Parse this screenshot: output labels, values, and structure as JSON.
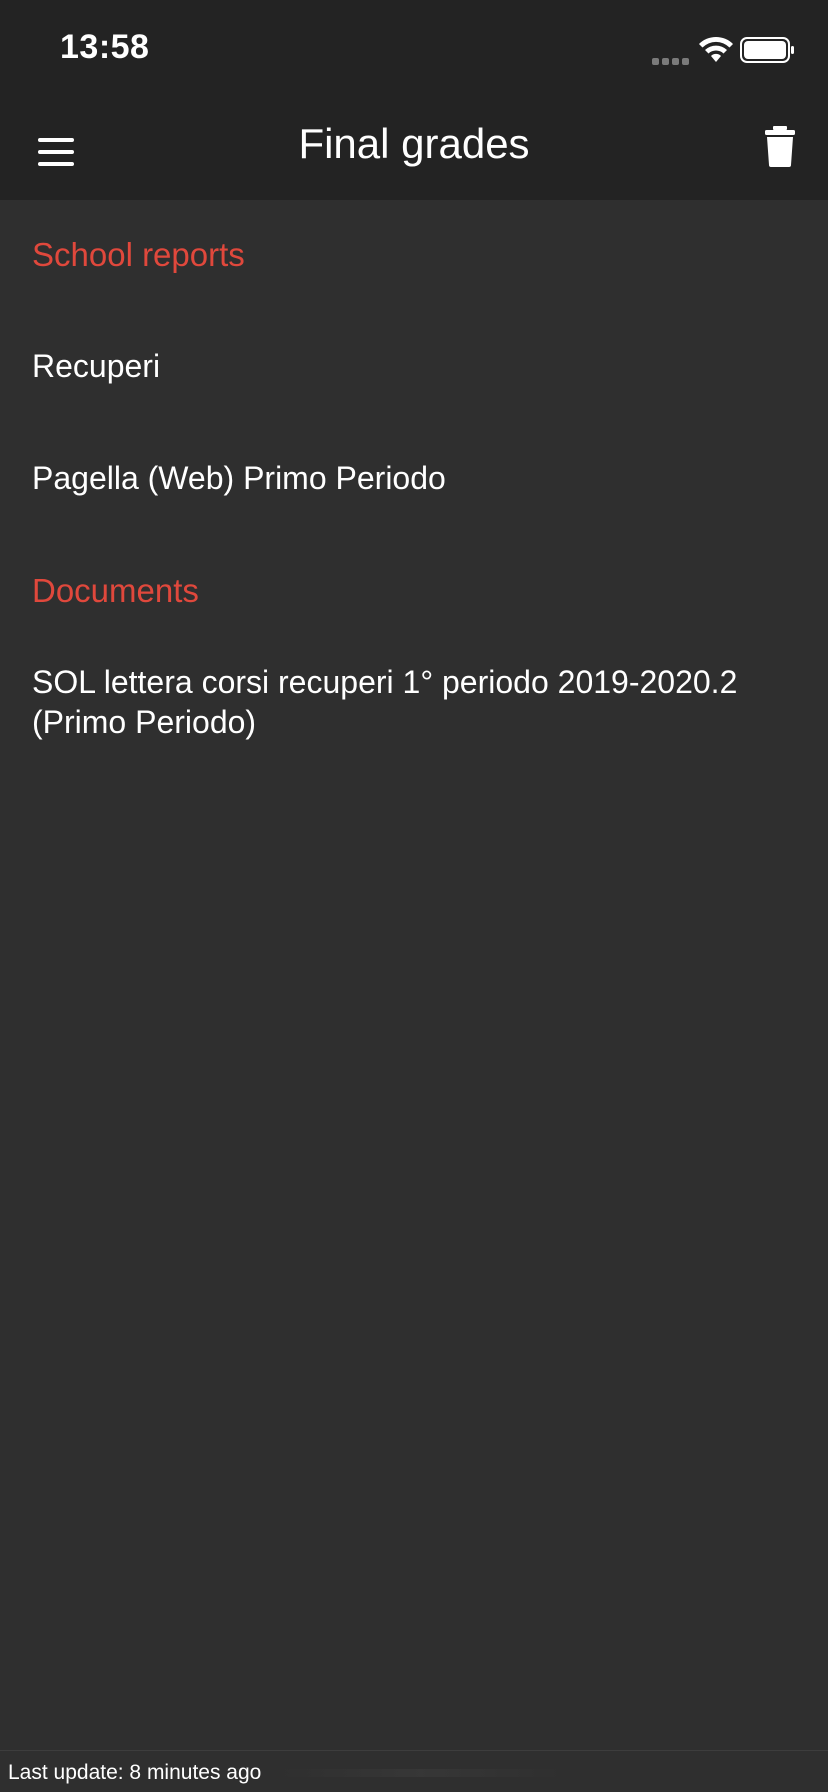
{
  "status_bar": {
    "time": "13:58"
  },
  "header": {
    "title": "Final grades",
    "menu_icon": "hamburger-menu-icon",
    "delete_icon": "trash-icon"
  },
  "sections": [
    {
      "title": "School reports",
      "items": [
        {
          "label": "Recuperi"
        },
        {
          "label": "Pagella (Web) Primo Periodo"
        }
      ]
    },
    {
      "title": "Documents",
      "items": [
        {
          "label": "SOL lettera corsi recuperi 1° periodo 2019-2020.2 (Primo Periodo)"
        }
      ]
    }
  ],
  "footer": {
    "last_update": "Last update: 8 minutes ago"
  },
  "colors": {
    "background": "#2f2f2f",
    "bar_background": "#232323",
    "section_accent": "#e0483c",
    "text": "#ffffff"
  }
}
